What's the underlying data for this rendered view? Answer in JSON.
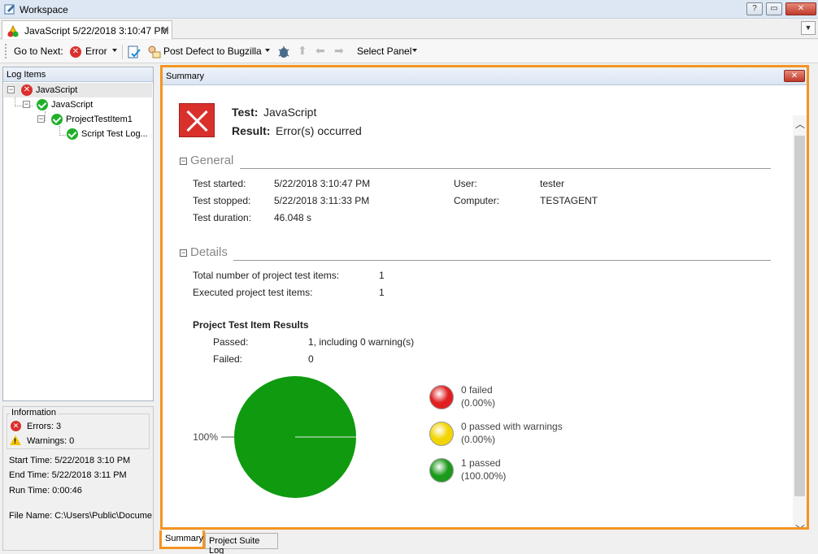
{
  "window": {
    "title": "Workspace",
    "buttons": {
      "help": "?",
      "restore": "▭",
      "close": "✕"
    }
  },
  "doc_tab": {
    "label": "JavaScript 5/22/2018 3:10:47 PM",
    "close": "✕"
  },
  "toolbar": {
    "go_to_next": "Go to Next:",
    "error_filter": "Error",
    "post_defect": "Post Defect to Bugzilla",
    "select_panel": "Select Panel"
  },
  "log_items": {
    "header": "Log Items",
    "tree": [
      {
        "label": "JavaScript",
        "status": "error"
      },
      {
        "label": "JavaScript",
        "status": "ok"
      },
      {
        "label": "ProjectTestItem1",
        "status": "ok"
      },
      {
        "label": "Script Test Log...",
        "status": "ok"
      }
    ]
  },
  "information": {
    "legend": "Information",
    "errors": "Errors: 3",
    "warnings": "Warnings: 0",
    "start_time": "Start Time: 5/22/2018 3:10 PM",
    "end_time": "End Time: 5/22/2018 3:11 PM",
    "run_time": "Run Time: 0:00:46",
    "file_name": "File Name: C:\\Users\\Public\\Documen"
  },
  "summary": {
    "panel_title": "Summary",
    "test_label": "Test:",
    "test_value": "JavaScript",
    "result_label": "Result:",
    "result_value": "Error(s) occurred",
    "general": {
      "title": "General",
      "rows": [
        {
          "label": "Test started:",
          "value": "5/22/2018 3:10:47 PM"
        },
        {
          "label": "Test stopped:",
          "value": "5/22/2018 3:11:33 PM"
        },
        {
          "label": "Test duration:",
          "value": "46.048 s"
        }
      ],
      "right_rows": [
        {
          "label": "User:",
          "value": "tester"
        },
        {
          "label": "Computer:",
          "value": "TESTAGENT"
        }
      ]
    },
    "details": {
      "title": "Details",
      "rows": [
        {
          "label": "Total number of project test items:",
          "value": "1"
        },
        {
          "label": "Executed project test items:",
          "value": "1"
        }
      ]
    },
    "results": {
      "title": "Project Test Item Results",
      "passed_label": "Passed:",
      "passed_value": "1, including 0 warning(s)",
      "failed_label": "Failed:",
      "failed_value": "0"
    }
  },
  "chart_data": {
    "type": "pie",
    "categories": [
      "failed",
      "passed with warnings",
      "passed"
    ],
    "values": [
      0,
      0,
      1
    ],
    "slice_label": "100%",
    "legend": [
      {
        "line1": "0 failed",
        "line2": "(0.00%)",
        "color": "#e02020"
      },
      {
        "line1": "0 passed with warnings",
        "line2": "(0.00%)",
        "color": "#f2d400"
      },
      {
        "line1": "1 passed",
        "line2": "(100.00%)",
        "color": "#1b9a1b"
      }
    ],
    "colors": [
      "#e02020",
      "#f2d400",
      "#0f9a0f"
    ],
    "legend_position": "right"
  },
  "bottom_tabs": [
    {
      "label": "Summary",
      "active": true
    },
    {
      "label": "Project Suite Log",
      "active": false
    }
  ]
}
